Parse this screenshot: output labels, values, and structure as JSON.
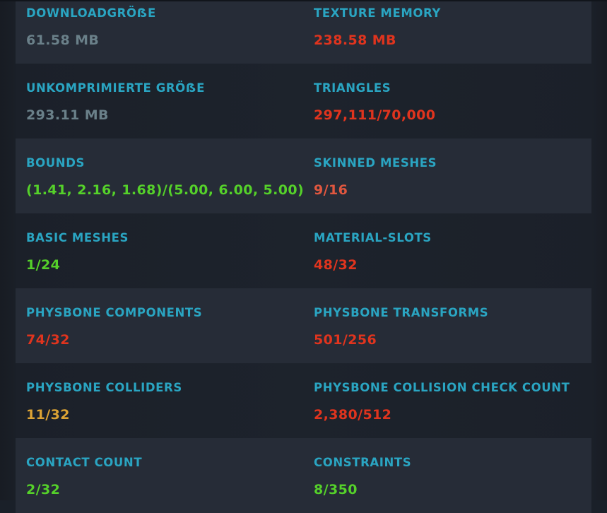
{
  "colors": {
    "label": "#2aa5c2",
    "neutral": "#6a8089",
    "bad": "#e0341e",
    "warn": "#e0573f",
    "ok": "#55d12a",
    "caution": "#dca334"
  },
  "rows": [
    {
      "left": {
        "label": "DOWNLOADGRÖẞE",
        "value": "61.58 MB",
        "status": "neutral"
      },
      "right": {
        "label": "TEXTURE MEMORY",
        "value": "238.58 MB",
        "status": "bad"
      }
    },
    {
      "left": {
        "label": "UNKOMPRIMIERTE GRÖẞE",
        "value": "293.11 MB",
        "status": "neutral"
      },
      "right": {
        "label": "TRIANGLES",
        "value": "297,111/70,000",
        "status": "bad"
      }
    },
    {
      "left": {
        "label": "BOUNDS",
        "value": "(1.41, 2.16, 1.68)/(5.00, 6.00, 5.00)",
        "status": "ok"
      },
      "right": {
        "label": "SKINNED MESHES",
        "value": "9/16",
        "status": "warn"
      }
    },
    {
      "left": {
        "label": "BASIC MESHES",
        "value": "1/24",
        "status": "ok"
      },
      "right": {
        "label": "MATERIAL-SLOTS",
        "value": "48/32",
        "status": "bad"
      }
    },
    {
      "left": {
        "label": "PHYSBONE COMPONENTS",
        "value": "74/32",
        "status": "bad"
      },
      "right": {
        "label": "PHYSBONE TRANSFORMS",
        "value": "501/256",
        "status": "bad"
      }
    },
    {
      "left": {
        "label": "PHYSBONE COLLIDERS",
        "value": "11/32",
        "status": "caution"
      },
      "right": {
        "label": "PHYSBONE COLLISION CHECK COUNT",
        "value": "2,380/512",
        "status": "bad"
      }
    },
    {
      "left": {
        "label": "CONTACT COUNT",
        "value": "2/32",
        "status": "ok"
      },
      "right": {
        "label": "CONSTRAINTS",
        "value": "8/350",
        "status": "ok"
      }
    }
  ]
}
